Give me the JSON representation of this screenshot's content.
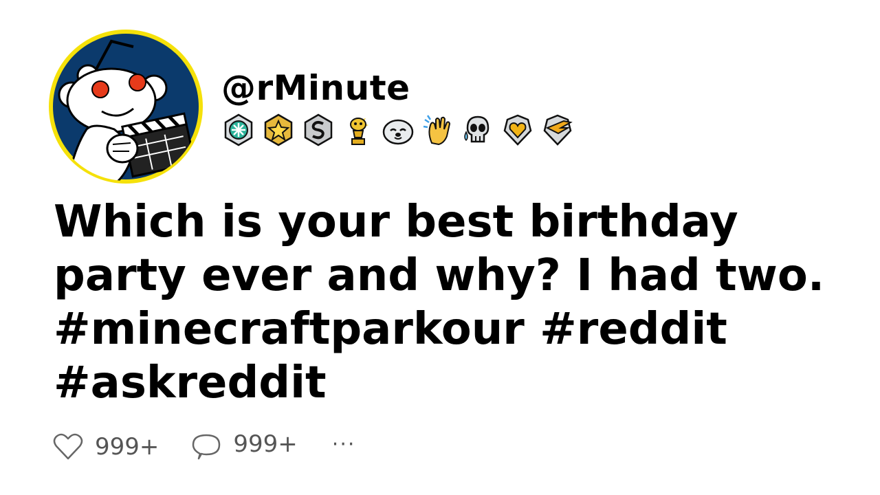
{
  "post": {
    "username": "@rMinute",
    "title": "Which is your best birthday party ever and why? I had two. #minecraftparkour #reddit #askreddit",
    "like_count": "999+",
    "comment_count": "999+",
    "more_label": "···"
  },
  "avatar": {
    "icon": "reddit-snoo-clapperboard-avatar",
    "ring_color": "#f5e10a",
    "background_color": "#0b3a6c"
  },
  "awards": [
    {
      "icon": "helpful-award-icon"
    },
    {
      "icon": "gold-star-award-icon"
    },
    {
      "icon": "silver-s-award-icon"
    },
    {
      "icon": "trophy-snoo-award-icon"
    },
    {
      "icon": "seal-award-icon"
    },
    {
      "icon": "clapping-hands-award-icon"
    },
    {
      "icon": "crying-skull-award-icon"
    },
    {
      "icon": "heart-shield-award-icon"
    },
    {
      "icon": "golden-wing-shield-award-icon"
    }
  ],
  "colors": {
    "text": "#000000",
    "muted": "#555555",
    "background": "#ffffff"
  }
}
